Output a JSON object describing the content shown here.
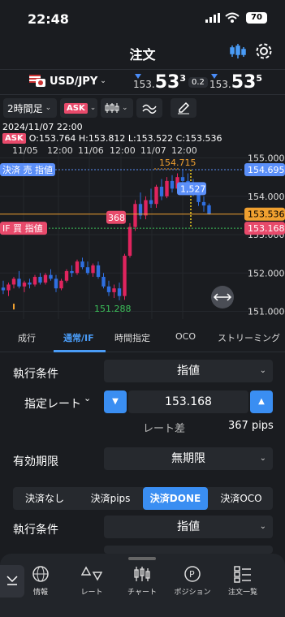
{
  "status": {
    "time": "22:48",
    "battery": "70"
  },
  "header": {
    "title": "注文"
  },
  "pair": {
    "name": "USD/JPY",
    "bid_small": "153.",
    "bid_big": "53",
    "bid_sup": "3",
    "spread": "0.2",
    "ask_small": "153.",
    "ask_big": "53",
    "ask_sup": "5"
  },
  "toolbar": {
    "period": "2時間足",
    "ask": "ASK"
  },
  "info": {
    "date": "2024/11/07 22:00",
    "ask": "ASK",
    "ohlc": "O:153.764  H:153.812  L:153.522  C:153.536"
  },
  "chart_data": {
    "type": "candlestick",
    "x_labels": [
      "11/05",
      "12:00",
      "11/06",
      "12:00",
      "11/07",
      "12:00"
    ],
    "y_ticks": [
      "155.000",
      "154.000",
      "153.000",
      "152.000",
      "151.000"
    ],
    "high_label": "154.715",
    "low_label": "151.288",
    "lines": [
      {
        "label": "決済 売 指値",
        "value": "154.695",
        "color": "#5b8ff9"
      },
      {
        "label": "IF 買 指値",
        "value": "153.168",
        "color": "#e84a6b"
      },
      {
        "value": "153.536",
        "color": "#f0a030"
      }
    ],
    "markers": {
      "pips_up": "1,527",
      "pips_down": "368"
    },
    "candles": [
      {
        "o": 151.62,
        "h": 151.8,
        "l": 151.45,
        "c": 151.55
      },
      {
        "o": 151.55,
        "h": 151.75,
        "l": 151.4,
        "c": 151.7
      },
      {
        "o": 151.7,
        "h": 151.9,
        "l": 151.6,
        "c": 151.85
      },
      {
        "o": 151.85,
        "h": 152.05,
        "l": 151.6,
        "c": 151.65
      },
      {
        "o": 151.65,
        "h": 151.8,
        "l": 151.5,
        "c": 151.75
      },
      {
        "o": 151.75,
        "h": 151.85,
        "l": 151.6,
        "c": 151.7
      },
      {
        "o": 151.7,
        "h": 151.95,
        "l": 151.65,
        "c": 151.9
      },
      {
        "o": 151.9,
        "h": 152.0,
        "l": 151.7,
        "c": 151.75
      },
      {
        "o": 151.75,
        "h": 152.0,
        "l": 151.7,
        "c": 151.95
      },
      {
        "o": 151.95,
        "h": 152.1,
        "l": 151.8,
        "c": 151.85
      },
      {
        "o": 151.85,
        "h": 151.95,
        "l": 151.5,
        "c": 151.6
      },
      {
        "o": 151.6,
        "h": 151.85,
        "l": 151.55,
        "c": 151.8
      },
      {
        "o": 151.8,
        "h": 152.1,
        "l": 151.75,
        "c": 152.05
      },
      {
        "o": 152.05,
        "h": 152.2,
        "l": 151.9,
        "c": 152.0
      },
      {
        "o": 152.0,
        "h": 152.35,
        "l": 151.95,
        "c": 152.3
      },
      {
        "o": 152.3,
        "h": 152.4,
        "l": 152.1,
        "c": 152.15
      },
      {
        "o": 152.15,
        "h": 152.3,
        "l": 151.95,
        "c": 152.0
      },
      {
        "o": 152.0,
        "h": 152.25,
        "l": 151.9,
        "c": 152.2
      },
      {
        "o": 152.2,
        "h": 152.3,
        "l": 151.85,
        "c": 151.9
      },
      {
        "o": 151.9,
        "h": 152.0,
        "l": 151.6,
        "c": 151.65
      },
      {
        "o": 151.65,
        "h": 151.8,
        "l": 151.4,
        "c": 151.5
      },
      {
        "o": 151.5,
        "h": 151.7,
        "l": 151.35,
        "c": 151.6
      },
      {
        "o": 151.6,
        "h": 151.75,
        "l": 151.29,
        "c": 151.4
      },
      {
        "o": 151.4,
        "h": 152.5,
        "l": 151.3,
        "c": 152.45
      },
      {
        "o": 152.45,
        "h": 153.3,
        "l": 152.4,
        "c": 153.2
      },
      {
        "o": 153.2,
        "h": 153.9,
        "l": 153.1,
        "c": 153.8
      },
      {
        "o": 153.8,
        "h": 154.1,
        "l": 153.4,
        "c": 153.5
      },
      {
        "o": 153.5,
        "h": 154.0,
        "l": 153.4,
        "c": 153.9
      },
      {
        "o": 153.9,
        "h": 154.2,
        "l": 153.7,
        "c": 153.8
      },
      {
        "o": 153.8,
        "h": 154.3,
        "l": 153.7,
        "c": 154.25
      },
      {
        "o": 154.25,
        "h": 154.45,
        "l": 153.9,
        "c": 154.0
      },
      {
        "o": 154.0,
        "h": 154.5,
        "l": 153.95,
        "c": 154.4
      },
      {
        "o": 154.4,
        "h": 154.55,
        "l": 154.1,
        "c": 154.2
      },
      {
        "o": 154.2,
        "h": 154.6,
        "l": 154.1,
        "c": 154.5
      },
      {
        "o": 154.5,
        "h": 154.715,
        "l": 154.3,
        "c": 154.4
      },
      {
        "o": 154.4,
        "h": 154.6,
        "l": 154.15,
        "c": 154.25
      },
      {
        "o": 154.25,
        "h": 154.45,
        "l": 154.0,
        "c": 154.05
      },
      {
        "o": 154.05,
        "h": 154.15,
        "l": 153.75,
        "c": 153.85
      },
      {
        "o": 153.85,
        "h": 154.0,
        "l": 153.6,
        "c": 153.76
      },
      {
        "o": 153.764,
        "h": 153.812,
        "l": 153.522,
        "c": 153.536
      }
    ]
  },
  "tabs": [
    "成行",
    "通常/IF",
    "時間指定",
    "OCO",
    "ストリーミング"
  ],
  "form": {
    "cond_label": "執行条件",
    "cond_value": "指値",
    "rate_label": "指定レート",
    "rate_value": "153.168",
    "diff_label": "レート差",
    "diff_value": "367 pips",
    "expiry_label": "有効期限",
    "expiry_value": "無期限",
    "seg": [
      "決済なし",
      "決済pips",
      "決済DONE",
      "決済OCO"
    ],
    "cond2_label": "執行条件",
    "cond2_value": "指値"
  },
  "nav": [
    "情報",
    "レート",
    "チャート",
    "ポジション",
    "注文一覧"
  ]
}
